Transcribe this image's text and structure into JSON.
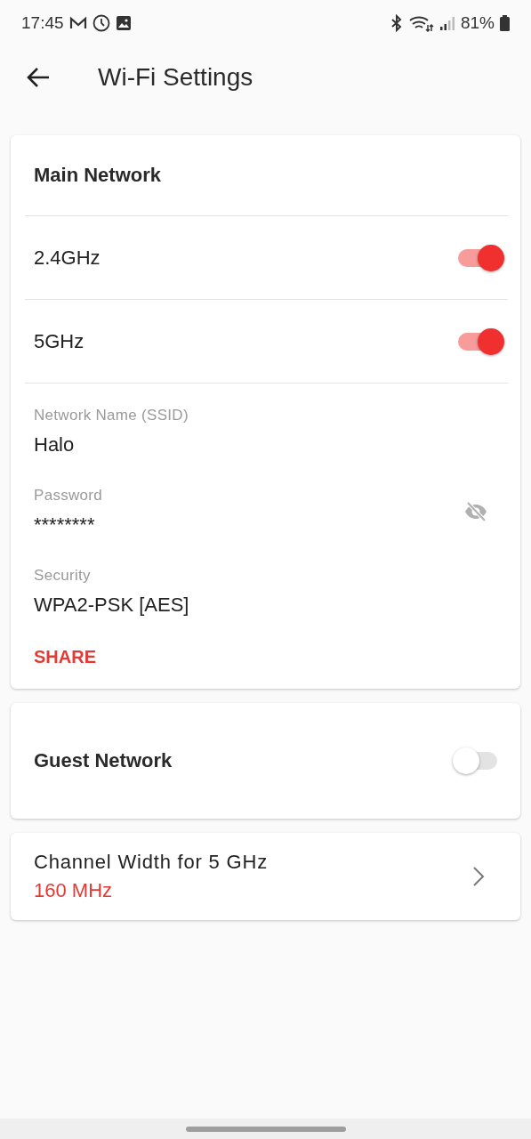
{
  "status_bar": {
    "time": "17:45",
    "battery": "81%"
  },
  "header": {
    "title": "Wi‑Fi Settings"
  },
  "main_network": {
    "title": "Main Network",
    "bands": [
      {
        "label": "2.4GHz",
        "on": true
      },
      {
        "label": "5GHz",
        "on": true
      }
    ],
    "fields": [
      {
        "kind": "text",
        "label": "Network Name (SSID)",
        "value": "Halo"
      },
      {
        "kind": "password",
        "label": "Password",
        "value": "********"
      },
      {
        "kind": "text",
        "label": "Security",
        "value": "WPA2-PSK [AES]"
      }
    ],
    "share_button": "SHARE"
  },
  "guest_network": {
    "label": "Guest Network",
    "on": false
  },
  "channel_width": {
    "label": "Channel Width for 5 GHz",
    "value": "160 MHz"
  }
}
